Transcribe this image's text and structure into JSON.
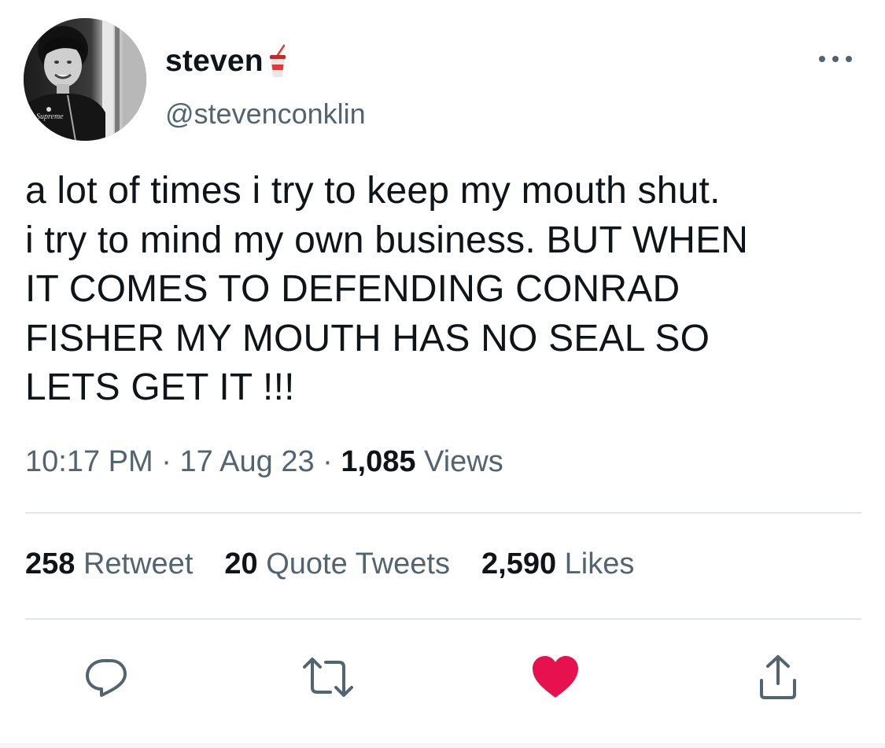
{
  "user": {
    "display_name": "steven",
    "handle": "@stevenconklin",
    "name_emoji_icon": "cup-with-straw-icon",
    "avatar_shirt_text": "Supreme"
  },
  "tweet": {
    "lines": [
      "a lot of times i try to keep my mouth shut.",
      "i try to mind my own business. BUT WHEN",
      "IT COMES TO DEFENDING CONRAD",
      "FISHER MY MOUTH HAS NO SEAL SO",
      "LETS GET IT !!!"
    ],
    "time": "10:17 PM",
    "separator": "·",
    "date": "17 Aug 23",
    "views_count": "1,085",
    "views_label": "Views"
  },
  "stats": {
    "retweets_count": "258",
    "retweets_label": "Retweet",
    "quotes_count": "20",
    "quotes_label": "Quote Tweets",
    "likes_count": "2,590",
    "likes_label": "Likes"
  },
  "actions": [
    {
      "icon": "reply-icon"
    },
    {
      "icon": "retweet-icon"
    },
    {
      "icon": "heart-icon",
      "active": true
    },
    {
      "icon": "share-icon"
    }
  ],
  "colors": {
    "text": "#0f1419",
    "secondary": "#536471",
    "divider": "#e1e6ea",
    "like": "#f91880"
  }
}
